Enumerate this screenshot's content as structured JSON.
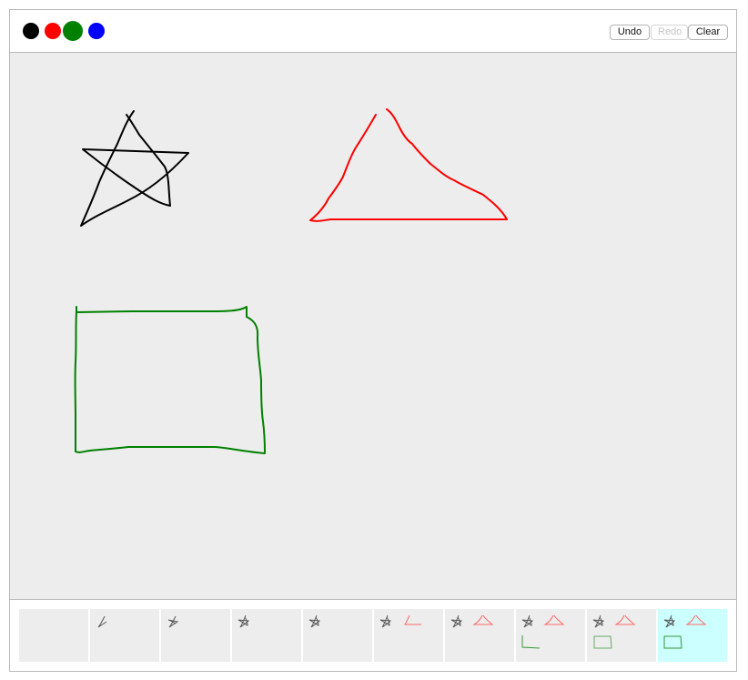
{
  "toolbar": {
    "colors": [
      {
        "name": "black",
        "hex": "#000000",
        "selected": false
      },
      {
        "name": "red",
        "hex": "#ff0000",
        "selected": false
      },
      {
        "name": "green",
        "hex": "#008000",
        "selected": true
      },
      {
        "name": "blue",
        "hex": "#0000ff",
        "selected": false
      }
    ],
    "undo_label": "Undo",
    "redo_label": "Redo",
    "clear_label": "Clear",
    "redo_enabled": false
  },
  "canvas": {
    "background": "#ededed",
    "strokes": [
      {
        "name": "star",
        "color": "#000000"
      },
      {
        "name": "triangle",
        "color": "#ff0000"
      },
      {
        "name": "rectangle",
        "color": "#008000"
      }
    ]
  },
  "history": {
    "current_index": 9,
    "current_background": "#ccffff",
    "snapshots": [
      {
        "label": "empty",
        "contents": []
      },
      {
        "label": "star-step-1",
        "contents": [
          "star-partial-1"
        ]
      },
      {
        "label": "star-step-2",
        "contents": [
          "star-partial-2"
        ]
      },
      {
        "label": "star-step-3",
        "contents": [
          "star"
        ]
      },
      {
        "label": "star-complete",
        "contents": [
          "star"
        ]
      },
      {
        "label": "triangle-partial",
        "contents": [
          "star",
          "triangle-partial"
        ]
      },
      {
        "label": "triangle-complete",
        "contents": [
          "star",
          "triangle"
        ]
      },
      {
        "label": "rectangle-partial",
        "contents": [
          "star",
          "triangle",
          "rectangle-partial"
        ]
      },
      {
        "label": "rectangle-faded",
        "contents": [
          "star",
          "triangle",
          "rectangle"
        ]
      },
      {
        "label": "rectangle-complete",
        "contents": [
          "star",
          "triangle",
          "rectangle"
        ]
      }
    ]
  }
}
